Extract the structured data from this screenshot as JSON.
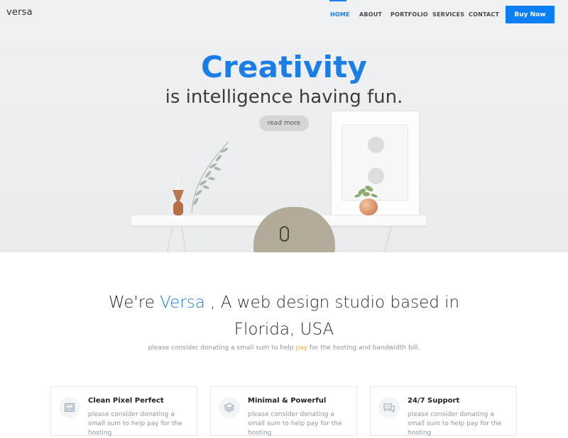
{
  "brand": "versa",
  "nav": {
    "items": [
      {
        "label": "HOME",
        "active": true
      },
      {
        "label": "ABOUT",
        "active": false
      },
      {
        "label": "PORTFOLIO",
        "active": false
      },
      {
        "label": "SERVICES",
        "active": false
      },
      {
        "label": "CONTACT",
        "active": false
      }
    ],
    "cta_label": "Buy Now"
  },
  "hero": {
    "title": "Creativity",
    "subtitle": "is intelligence having fun.",
    "button_label": "read more"
  },
  "about": {
    "title_prefix": "We're ",
    "title_accent": "Versa",
    "title_suffix": " , A web design studio based in Florida, USA",
    "note_prefix": "please consider donating a small sum to help ",
    "note_accent": "pay",
    "note_suffix": " for the hosting and bandwidth bill."
  },
  "features": [
    {
      "icon": "image-icon",
      "title": "Clean Pixel Perfect",
      "text": "please consider donating a small sum to help pay for the hosting"
    },
    {
      "icon": "layers-icon",
      "title": "Minimal & Powerful",
      "text": "please consider donating a small sum to help pay for the hosting"
    },
    {
      "icon": "chat-icon",
      "title": "24/7 Support",
      "text": "please consider donating a small sum to help pay for the hosting"
    }
  ],
  "colors": {
    "accent": "#1a7ee6",
    "cta_background": "#0a7ff5",
    "highlight": "#f0b43c"
  }
}
